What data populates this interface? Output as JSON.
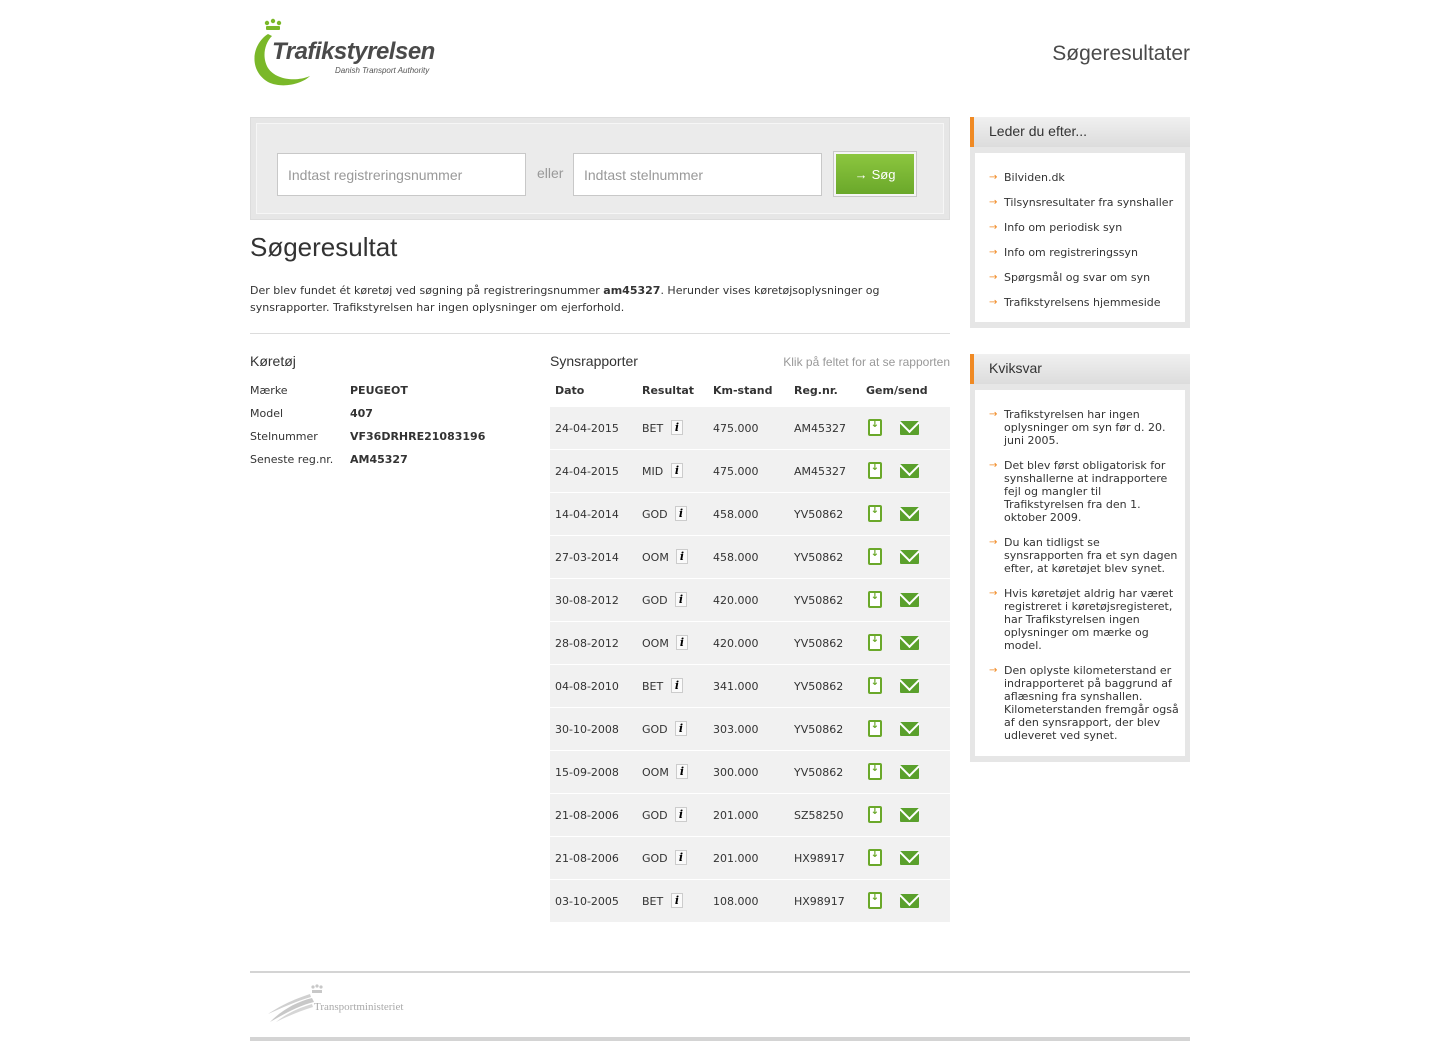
{
  "header": {
    "logo_name": "Trafikstyrelsen",
    "logo_tagline": "Danish Transport Authority",
    "page_heading": "Søgeresultater"
  },
  "search": {
    "reg_placeholder": "Indtast registreringsnummer",
    "or_label": "eller",
    "stel_placeholder": "Indtast stelnummer",
    "button_label": "Søg"
  },
  "result": {
    "title": "Søgeresultat",
    "text_before": "Der blev fundet ét køretøj ved søgning på registreringsnummer ",
    "query": "am45327",
    "text_after": ". Herunder vises køretøjsoplysninger og synsrapporter. Trafikstyrelsen har ingen oplysninger om ejerforhold."
  },
  "vehicle": {
    "title": "Køretøj",
    "rows": [
      {
        "label": "Mærke",
        "value": "PEUGEOT"
      },
      {
        "label": "Model",
        "value": "407"
      },
      {
        "label": "Stelnummer",
        "value": "VF36DRHRE21083196"
      },
      {
        "label": "Seneste reg.nr.",
        "value": "AM45327"
      }
    ]
  },
  "reports": {
    "title": "Synsrapporter",
    "hint": "Klik på feltet for at se rapporten",
    "columns": [
      "Dato",
      "Resultat",
      "Km-stand",
      "Reg.nr.",
      "Gem/send"
    ],
    "rows": [
      {
        "date": "24-04-2015",
        "result": "BET",
        "km": "475.000",
        "reg": "AM45327"
      },
      {
        "date": "24-04-2015",
        "result": "MID",
        "km": "475.000",
        "reg": "AM45327"
      },
      {
        "date": "14-04-2014",
        "result": "GOD",
        "km": "458.000",
        "reg": "YV50862"
      },
      {
        "date": "27-03-2014",
        "result": "OOM",
        "km": "458.000",
        "reg": "YV50862"
      },
      {
        "date": "30-08-2012",
        "result": "GOD",
        "km": "420.000",
        "reg": "YV50862"
      },
      {
        "date": "28-08-2012",
        "result": "OOM",
        "km": "420.000",
        "reg": "YV50862"
      },
      {
        "date": "04-08-2010",
        "result": "BET",
        "km": "341.000",
        "reg": "YV50862"
      },
      {
        "date": "30-10-2008",
        "result": "GOD",
        "km": "303.000",
        "reg": "YV50862"
      },
      {
        "date": "15-09-2008",
        "result": "OOM",
        "km": "300.000",
        "reg": "YV50862"
      },
      {
        "date": "21-08-2006",
        "result": "GOD",
        "km": "201.000",
        "reg": "SZ58250"
      },
      {
        "date": "21-08-2006",
        "result": "GOD",
        "km": "201.000",
        "reg": "HX98917"
      },
      {
        "date": "03-10-2005",
        "result": "BET",
        "km": "108.000",
        "reg": "HX98917"
      }
    ]
  },
  "sidebar": {
    "looking_title": "Leder du efter...",
    "looking_links": [
      "Bilviden.dk",
      "Tilsynsresultater fra synshaller",
      "Info om periodisk syn",
      "Info om registreringssyn",
      "Spørgsmål og svar om syn",
      "Trafikstyrelsens hjemmeside"
    ],
    "quick_title": "Kviksvar",
    "quick_items": [
      "Trafikstyrelsen har ingen oplysninger om syn før d. 20. juni 2005.",
      "Det blev først obligatorisk for synshallerne at indrapportere fejl og mangler til Trafikstyrelsen fra den 1. oktober 2009.",
      "Du kan tidligst se synsrapporten fra et syn dagen efter, at køretøjet blev synet.",
      "Hvis køretøjet aldrig har været registreret i køretøjsregisteret, har Trafikstyrelsen ingen oplysninger om mærke og model.",
      "Den oplyste kilometerstand er indrapporteret på baggrund af aflæsning fra synshallen. Kilometerstanden fremgår også af den synsrapport, der blev udleveret ved synet."
    ]
  },
  "footer": {
    "ministry": "Transportministeriet"
  },
  "colors": {
    "brand_green": "#6aa82a",
    "accent_orange": "#f08a24"
  }
}
